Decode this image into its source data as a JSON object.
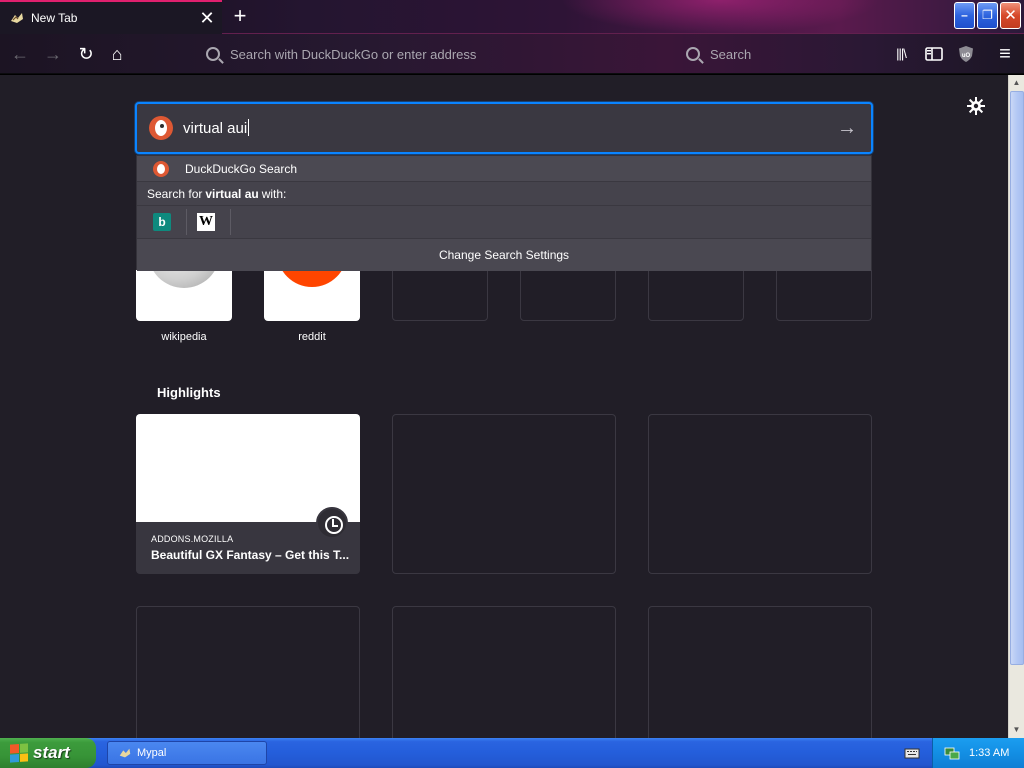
{
  "window": {
    "tab_title": "New Tab",
    "tab_close": "✕",
    "new_tab": "+",
    "min": "–",
    "max": "❐",
    "close": "✕"
  },
  "toolbar": {
    "back": "←",
    "forward": "→",
    "reload": "↻",
    "home": "⌂",
    "url_placeholder": "Search with DuckDuckGo or enter address",
    "search_placeholder": "Search",
    "library": "|||\\",
    "sidebar": "▯",
    "menu": "≡"
  },
  "search": {
    "query": "virtual aui",
    "go": "→",
    "settings_icon": "gear-icon"
  },
  "dropdown": {
    "engine_result": "DuckDuckGo Search",
    "search_for_prefix": "Search for",
    "search_for_term": "virtual au",
    "search_for_suffix": "with:",
    "engines": [
      "b",
      "W"
    ],
    "change_settings": "Change Search Settings"
  },
  "top_sites": [
    {
      "label": "wikipedia"
    },
    {
      "label": "reddit"
    }
  ],
  "highlights": {
    "title": "Highlights",
    "card": {
      "host": "ADDONS.MOZILLA",
      "title": "Beautiful GX Fantasy – Get this T..."
    }
  },
  "taskbar": {
    "start": "start",
    "task": "Mypal",
    "time": "1:33 AM"
  },
  "colors": {
    "accent": "#0a84ff",
    "tab_accent": "#e0206e",
    "content_bg": "#211e27",
    "ddg": "#de5833",
    "reddit": "#ff4500"
  }
}
